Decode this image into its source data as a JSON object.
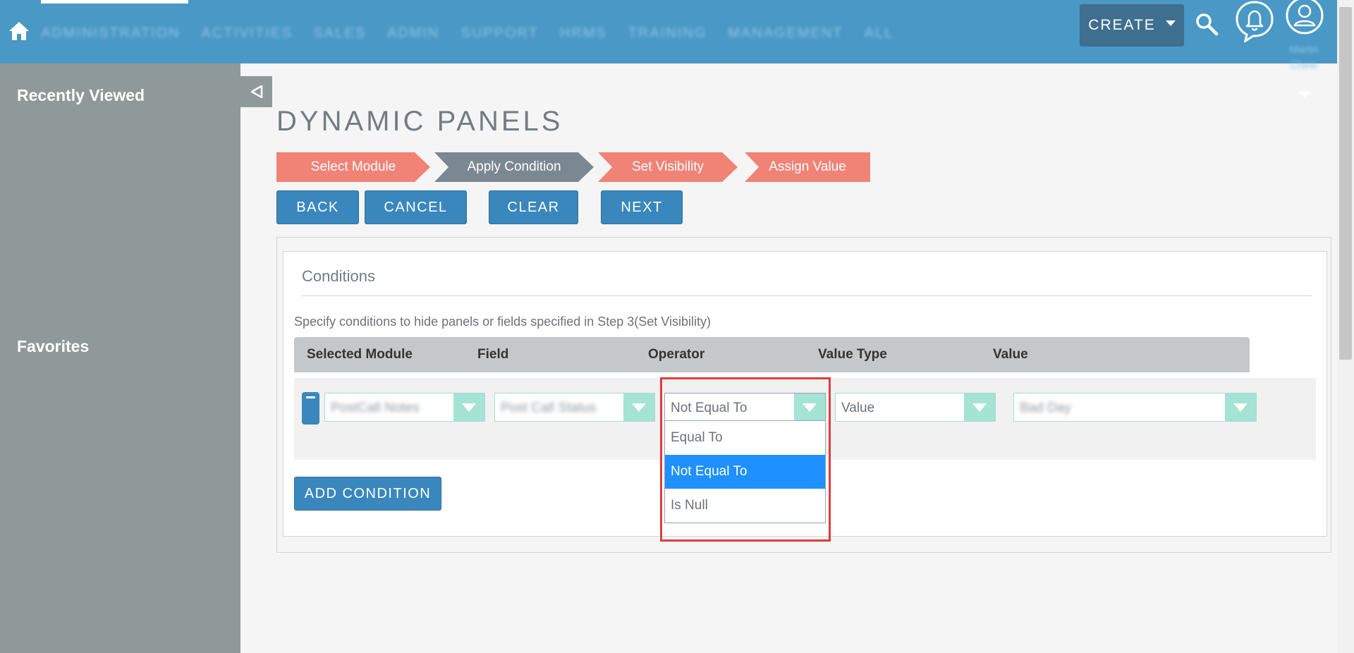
{
  "nav": {
    "menu": [
      "ADMINISTRATION",
      "ACTIVITIES",
      "SALES",
      "ADMIN",
      "SUPPORT",
      "HRMS",
      "TRAINING",
      "MANAGEMENT",
      "ALL"
    ],
    "create_label": "CREATE",
    "user_name": "Martin Chew"
  },
  "sidebar": {
    "recently_viewed": "Recently Viewed",
    "favorites": "Favorites"
  },
  "page": {
    "title": "DYNAMIC PANELS",
    "steps": [
      "Select Module",
      "Apply Condition",
      "Set Visibility",
      "Assign Value"
    ],
    "active_step": "Apply Condition",
    "buttons": {
      "back": "BACK",
      "cancel": "CANCEL",
      "clear": "CLEAR",
      "next": "NEXT"
    }
  },
  "conditions": {
    "title": "Conditions",
    "description": "Specify conditions to hide panels or fields specified in Step 3(Set Visibility)",
    "columns": [
      "Selected Module",
      "Field",
      "Operator",
      "Value Type",
      "Value"
    ],
    "row": {
      "module": "PostCall Notes",
      "field": "Post Call Status",
      "operator": "Not Equal To",
      "value_type": "Value",
      "value": "Bad Day"
    },
    "operator_options": [
      "Equal To",
      "Not Equal To",
      "Is Null"
    ],
    "selected_operator": "Not Equal To",
    "add_label": "ADD CONDITION"
  },
  "colors": {
    "nav_bg": "#4a98c6",
    "sidebar_bg": "#8f9999",
    "step_inactive": "#f08376",
    "step_active": "#7b8791",
    "button_bg": "#3a87bd",
    "select_arrow": "#a5e3d4",
    "highlight": "#e03c3c"
  }
}
